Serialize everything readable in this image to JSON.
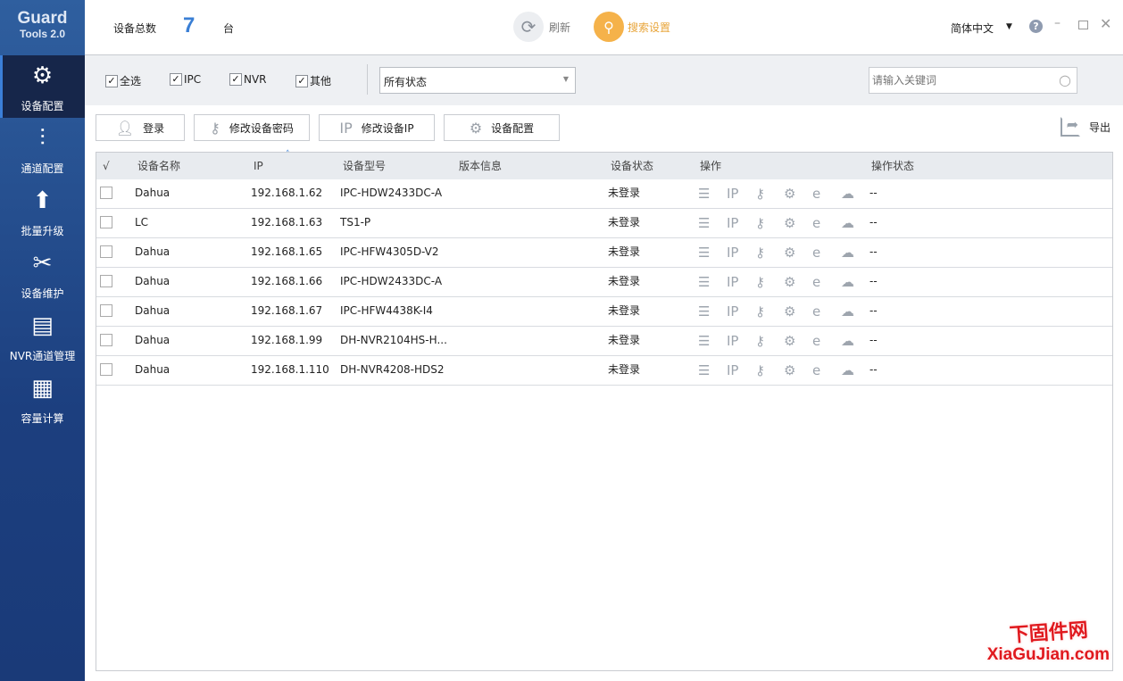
{
  "app": {
    "logo_line1": "Guard",
    "logo_line2": "Tools 2.0"
  },
  "sidebar": {
    "items": [
      {
        "label": "设备配置",
        "icon": "gear-icon",
        "active": true
      },
      {
        "label": "通道配置",
        "icon": "sliders-icon"
      },
      {
        "label": "批量升级",
        "icon": "upgrade-icon"
      },
      {
        "label": "设备维护",
        "icon": "tools-icon"
      },
      {
        "label": "NVR通道管理",
        "icon": "nvr-icon"
      },
      {
        "label": "容量计算",
        "icon": "calculator-icon"
      }
    ]
  },
  "header": {
    "total_label": "设备总数",
    "total_count": "7",
    "unit": "台",
    "refresh": "刷新",
    "search_settings": "搜索设置",
    "language": "简体中文",
    "accent": "#f5b24a",
    "count_color": "#3a7fd5"
  },
  "filter": {
    "checkboxes": [
      {
        "label": "全选",
        "checked": true
      },
      {
        "label": "IPC",
        "checked": true
      },
      {
        "label": "NVR",
        "checked": true
      },
      {
        "label": "其他",
        "checked": true
      }
    ],
    "status_select": "所有状态",
    "search_placeholder": "请输入关键词"
  },
  "toolbar": {
    "login": "登录",
    "change_password": "修改设备密码",
    "change_ip": "修改设备IP",
    "ip_icon_text": "IP",
    "device_config": "设备配置",
    "export": "导出"
  },
  "table": {
    "columns": [
      "√",
      "设备名称",
      "IP",
      "设备型号",
      "版本信息",
      "设备状态",
      "操作",
      "操作状态"
    ],
    "rows": [
      {
        "name": "Dahua",
        "ip": "192.168.1.62",
        "model": "IPC-HDW2433DC-A",
        "version": "",
        "status": "未登录",
        "op_status": "--"
      },
      {
        "name": "LC",
        "ip": "192.168.1.63",
        "model": "TS1-P",
        "version": "",
        "status": "未登录",
        "op_status": "--"
      },
      {
        "name": "Dahua",
        "ip": "192.168.1.65",
        "model": "IPC-HFW4305D-V2",
        "version": "",
        "status": "未登录",
        "op_status": "--"
      },
      {
        "name": "Dahua",
        "ip": "192.168.1.66",
        "model": "IPC-HDW2433DC-A",
        "version": "",
        "status": "未登录",
        "op_status": "--"
      },
      {
        "name": "Dahua",
        "ip": "192.168.1.67",
        "model": "IPC-HFW4438K-I4",
        "version": "",
        "status": "未登录",
        "op_status": "--"
      },
      {
        "name": "Dahua",
        "ip": "192.168.1.99",
        "model": "DH-NVR2104HS-H...",
        "version": "",
        "status": "未登录",
        "op_status": "--"
      },
      {
        "name": "Dahua",
        "ip": "192.168.1.110",
        "model": "DH-NVR4208-HDS2",
        "version": "",
        "status": "未登录",
        "op_status": "--"
      }
    ],
    "op_icons": [
      "details-icon",
      "ip-icon",
      "key-icon",
      "gear-icon",
      "browser-icon",
      "cloud-icon"
    ],
    "ip_op_text": "IP"
  },
  "watermark": {
    "line1": "下固件网",
    "line2": "XiaGuJian.com"
  }
}
